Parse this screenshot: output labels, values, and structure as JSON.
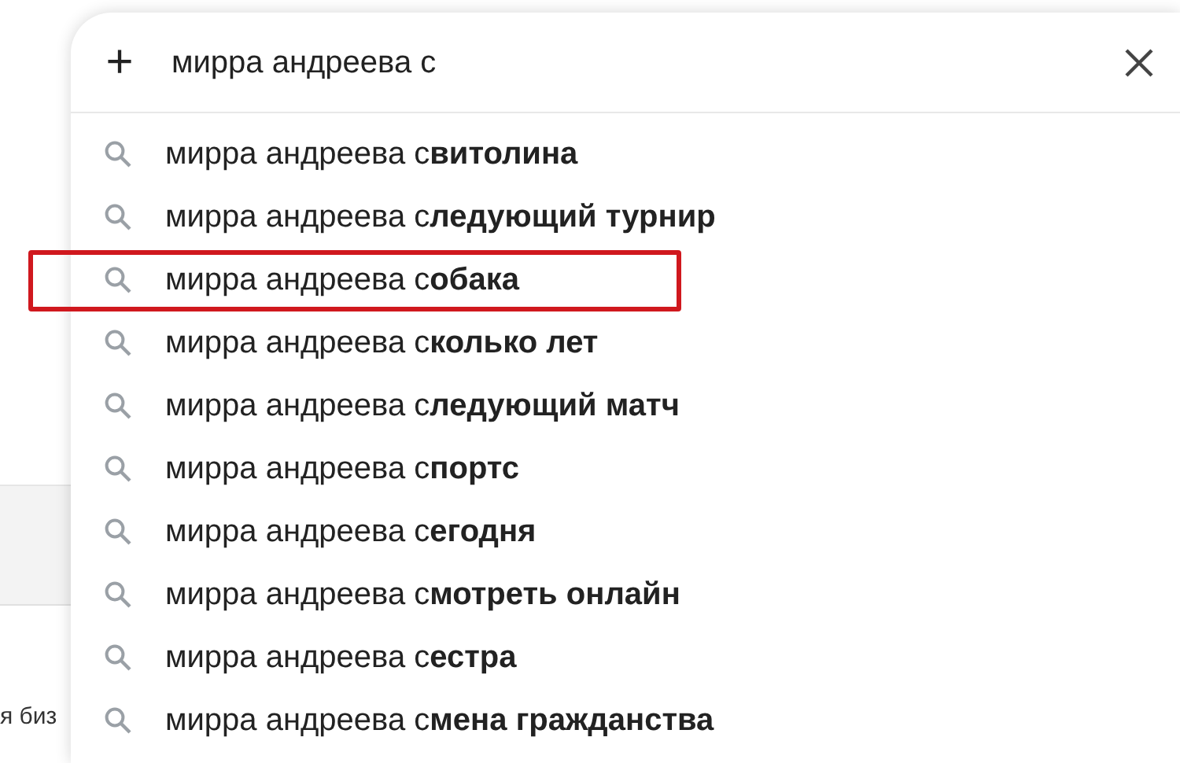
{
  "background": {
    "side_text": "я биз"
  },
  "search": {
    "add_symbol": "+",
    "value": "мирра андреева с"
  },
  "suggestions": [
    {
      "text": "мирра андреева с**витолина**",
      "highlighted": false
    },
    {
      "text": "мирра андреева с**ледующий турнир**",
      "highlighted": false
    },
    {
      "text": "мирра андреева с**обака**",
      "highlighted": true
    },
    {
      "text": "мирра андреева с**колько лет**",
      "highlighted": false
    },
    {
      "text": "мирра андреева с**ледующий матч**",
      "highlighted": false
    },
    {
      "text": "мирра андреева с**портс**",
      "highlighted": false
    },
    {
      "text": "мирра андреева с**егодня**",
      "highlighted": false
    },
    {
      "text": "мирра андреева с**мотреть онлайн**",
      "highlighted": false
    },
    {
      "text": "мирра андреева с**естра**",
      "highlighted": false
    },
    {
      "text": "мирра андреева с**мена гражданства**",
      "highlighted": false
    }
  ]
}
